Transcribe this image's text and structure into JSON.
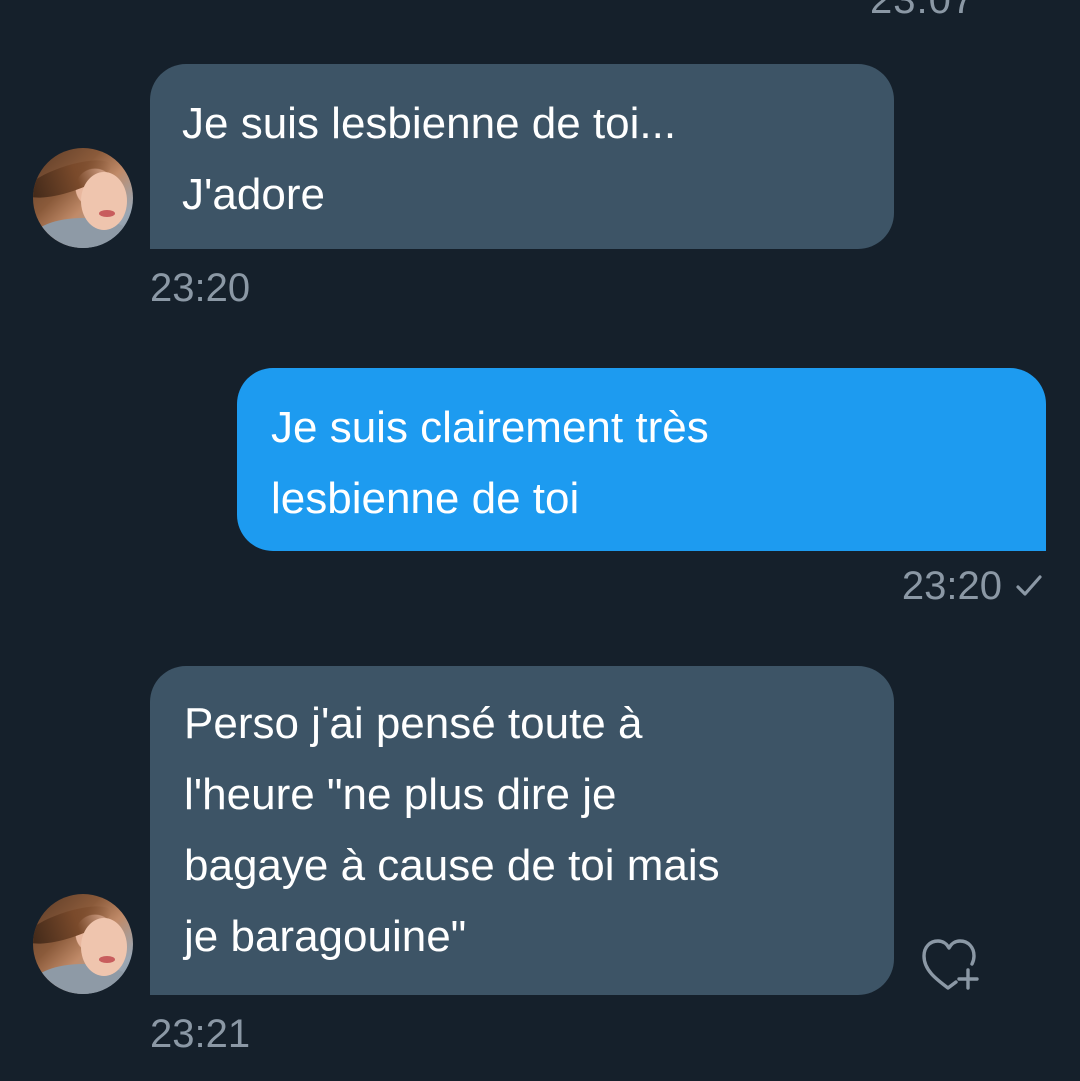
{
  "header": {
    "partial_time": "23:07"
  },
  "messages": [
    {
      "direction": "incoming",
      "lines": [
        "Je suis lesbienne de toi...",
        "J'adore"
      ],
      "time": "23:20"
    },
    {
      "direction": "outgoing",
      "lines": [
        "Je suis clairement très",
        "lesbienne de toi"
      ],
      "time": "23:20",
      "status": "sent"
    },
    {
      "direction": "incoming",
      "lines": [
        "Perso j'ai pensé toute à",
        "l'heure \"ne plus dire je",
        "bagaye à cause de toi mais",
        "je baragouine\""
      ],
      "time": "23:21"
    }
  ],
  "icons": {
    "read_status": "check-icon",
    "reaction": "heart-plus-icon",
    "avatar": "avatar-photo"
  },
  "colors": {
    "background": "#15202b",
    "incoming_bubble": "#3d5466",
    "outgoing_bubble": "#1d9bf0",
    "timestamp": "#8b98a5"
  }
}
